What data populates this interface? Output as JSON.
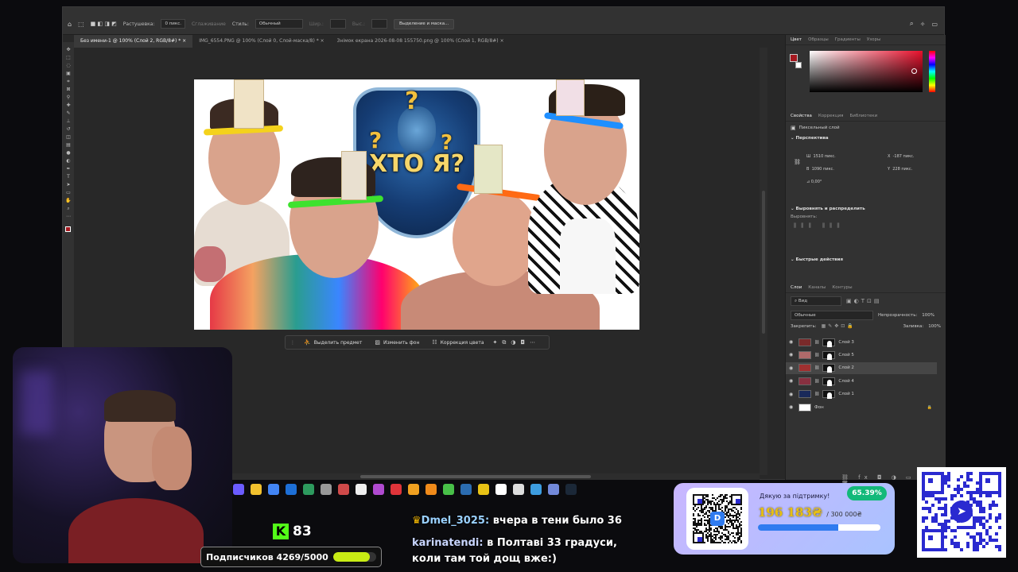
{
  "photoshop": {
    "options_bar": {
      "feather_label": "Растушевка:",
      "feather_value": "0 пикс.",
      "smoothing_label": "Сглаживание",
      "style_label": "Стиль:",
      "style_value": "Обычный",
      "width_label": "Шир.:",
      "height_label": "Выс.:",
      "select_mask_button": "Выделение и маска..."
    },
    "tabs": [
      {
        "label": "Без имени-1 @ 100% (Слой 2, RGB/8#) *",
        "active": true
      },
      {
        "label": "IMG_6554.PNG @ 100% (Слой 0, Слой-маска/8) *",
        "active": false
      },
      {
        "label": "Знімок екрана 2026-08-08 155750.png @ 100% (Слой 1, RGB/8#)",
        "active": false
      }
    ],
    "document": {
      "center_text": "ХТО Я?"
    },
    "contextual_bar": {
      "select_subject": "Выделить предмет",
      "change_background": "Изменить фон",
      "color_correction": "Коррекция цвета"
    },
    "color_panel": {
      "tabs": [
        "Цвет",
        "Образцы",
        "Градиенты",
        "Узоры"
      ],
      "foreground_color": "#a5181f"
    },
    "properties_panel": {
      "tabs": [
        "Свойства",
        "Коррекция",
        "Библиотеки"
      ],
      "layer_type": "Пиксельный слой",
      "transform_header": "Перспектива",
      "w_label": "Ш",
      "w_value": "1510 пикс.",
      "h_label": "В",
      "h_value": "1090 пикс.",
      "x_label": "X",
      "x_value": "-187 пикс.",
      "y_label": "Y",
      "y_value": "228 пикс.",
      "angle_value": "0,00°",
      "align_header": "Выровнять и распределить",
      "align_label": "Выровнять:",
      "quick_actions_header": "Быстрые действия"
    },
    "layers_panel": {
      "tabs": [
        "Слои",
        "Каналы",
        "Контуры"
      ],
      "filter_label": "Вид",
      "blend_mode": "Обычные",
      "opacity_label": "Непрозрачность:",
      "opacity_value": "100%",
      "lock_label": "Закрепить:",
      "fill_label": "Заливка:",
      "fill_value": "100%",
      "layers": [
        {
          "name": "Слой 3",
          "selected": false
        },
        {
          "name": "Слой 5",
          "selected": false
        },
        {
          "name": "Слой 2",
          "selected": true
        },
        {
          "name": "Слой 4",
          "selected": false
        },
        {
          "name": "Слой 1",
          "selected": false
        },
        {
          "name": "Фон",
          "selected": false
        }
      ]
    }
  },
  "stream_overlay": {
    "kick_followers": "83",
    "subscribers_text": "Подписчиков 4269/5000",
    "subscribers_progress": 0.8538,
    "chat": [
      {
        "user": "Dmel_3025:",
        "message": "вчера в тени было 36"
      },
      {
        "user": "karinatendi:",
        "message": "в Полтаві 33 градуси,"
      },
      {
        "user": "",
        "message": "коли там той дощ вже:)"
      }
    ],
    "donation": {
      "thanks": "Дякую за підтримку!",
      "percent": "65.39%",
      "amount": "196 183₴",
      "goal": "/ 300 000₴",
      "progress": 0.6539
    }
  }
}
